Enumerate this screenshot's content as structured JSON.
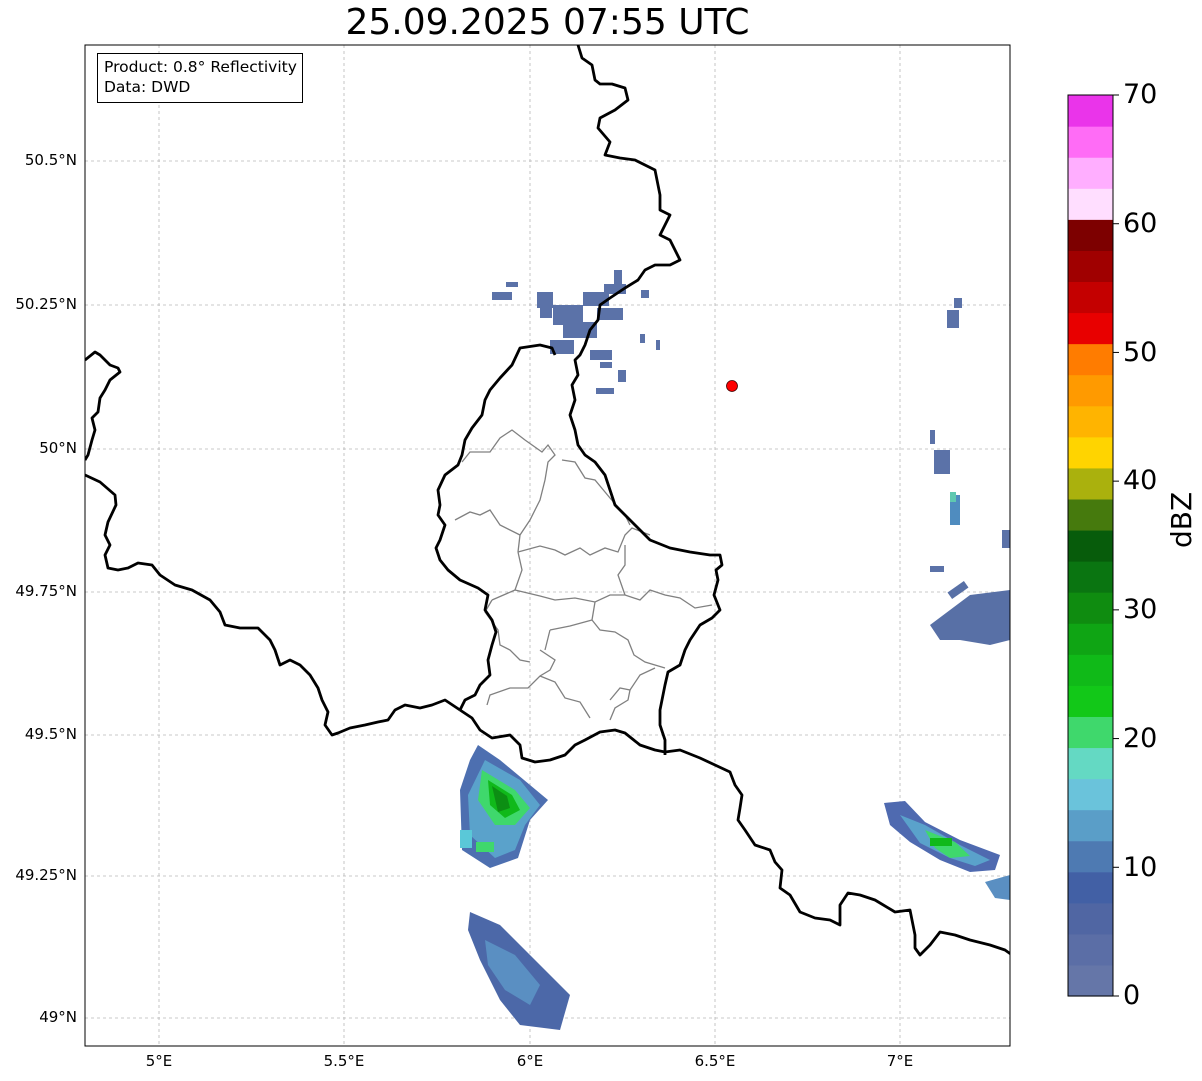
{
  "title": "25.09.2025 07:55 UTC",
  "info": {
    "product": "Product: 0.8° Reflectivity",
    "source": "Data: DWD"
  },
  "axes": {
    "lat_ticks": [
      "50.5°N",
      "50.25°N",
      "50°N",
      "49.75°N",
      "49.5°N",
      "49.25°N",
      "49°N"
    ],
    "lon_ticks": [
      "5°E",
      "5.5°E",
      "6°E",
      "6.5°E",
      "7°E"
    ],
    "lon_range": [
      4.8,
      7.3
    ],
    "lat_range": [
      48.95,
      50.7
    ],
    "grid": true
  },
  "marker": {
    "lon": 6.55,
    "lat": 50.11,
    "color": "#ff0000"
  },
  "colorbar": {
    "label": "dBZ",
    "ticks": [
      "0",
      "10",
      "20",
      "30",
      "40",
      "50",
      "60",
      "70"
    ],
    "range": [
      0,
      70
    ],
    "colors": [
      "#6576a8",
      "#5b6ea6",
      "#5066a3",
      "#4260a5",
      "#4e7ab2",
      "#5a9ec8",
      "#6ac3db",
      "#64d9c3",
      "#3fd86c",
      "#12c818",
      "#10ba18",
      "#0fa514",
      "#0f8c10",
      "#0a7511",
      "#075c0b",
      "#467a0d",
      "#aab10d",
      "#ffd400",
      "#ffb400",
      "#ff9a00",
      "#ff7c00",
      "#e80000",
      "#c40000",
      "#a00000",
      "#7d0000",
      "#ffdeff",
      "#ffaeff",
      "#ff6cf6",
      "#ea34ea"
    ]
  }
}
